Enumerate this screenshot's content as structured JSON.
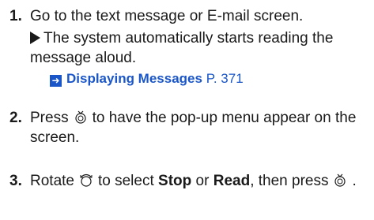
{
  "steps": [
    {
      "number": "1.",
      "text": "Go to the text message or E-mail screen.",
      "result": "The system automatically starts reading the message aloud.",
      "reference": {
        "title": "Displaying Messages",
        "page": "P. 371"
      }
    },
    {
      "number": "2.",
      "prefix": "Press",
      "suffix": "to have the pop-up menu appear on the screen.",
      "icon": "enter-knob-icon"
    },
    {
      "number": "3.",
      "prefix": "Rotate",
      "middle": "to select",
      "option1": "Stop",
      "or": "or",
      "option2": "Read",
      "then": ", then press",
      "end": ".",
      "icon_rotate": "rotate-knob-icon",
      "icon_press": "enter-knob-icon"
    }
  ],
  "colors": {
    "link": "#1a56c8",
    "text": "#1a1a1a"
  }
}
